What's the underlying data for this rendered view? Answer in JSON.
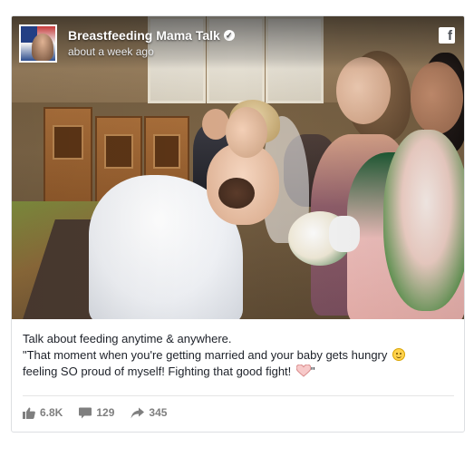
{
  "post": {
    "page_name": "Breastfeeding Mama Talk",
    "timestamp": "about a week ago",
    "platform_icon": "facebook-icon",
    "verified_icon": "verified-badge-icon",
    "caption_lines": [
      "Talk about feeding anytime & anywhere.",
      "\"That moment when you're getting married and your baby gets hungry",
      "feeling SO proud of myself! Fighting that good fight!",
      "\""
    ],
    "emojis": [
      "smile-emoji-icon",
      "heart-emoji-icon"
    ]
  },
  "stats": {
    "likes": "6.8K",
    "comments": "129",
    "shares": "345"
  },
  "colors": {
    "text": "#1d2129",
    "muted": "#7f7f7f",
    "border": "#dddfe2"
  }
}
